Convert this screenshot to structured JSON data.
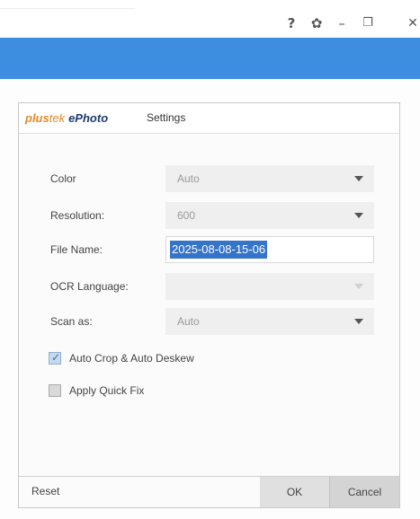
{
  "window": {
    "help_label": "?",
    "minimize_label": "–"
  },
  "panel": {
    "brand_plus": "plus",
    "brand_tek": "tek",
    "brand_ephoto": "ePhoto",
    "title": "Settings"
  },
  "settings": {
    "color": {
      "label": "Color",
      "value": "Auto"
    },
    "resolution": {
      "label": "Resolution:",
      "value": "600"
    },
    "file_name": {
      "label": "File Name:",
      "value": "2025-08-08-15-06"
    },
    "ocr_language": {
      "label": "OCR Language:",
      "value": ""
    },
    "scan_as": {
      "label": "Scan as:",
      "value": "Auto"
    }
  },
  "options": {
    "auto_crop": {
      "label": "Auto Crop & Auto Deskew",
      "checked": true
    },
    "quick_fix": {
      "label": "Apply Quick Fix",
      "checked": false
    }
  },
  "footer": {
    "reset_label": "Reset",
    "ok_label": "OK",
    "cancel_label": "Cancel"
  },
  "colors": {
    "accent_band": "#3d8de0",
    "selection": "#3574c9",
    "brand_orange": "#e8892a",
    "brand_navy": "#1f3a6e"
  },
  "icons": {
    "help": "help-icon",
    "settings": "gear-icon",
    "minimize": "minimize-icon",
    "restore": "restore-icon",
    "close": "close-icon",
    "dropdown": "chevron-down-icon",
    "check": "checkmark-icon"
  }
}
